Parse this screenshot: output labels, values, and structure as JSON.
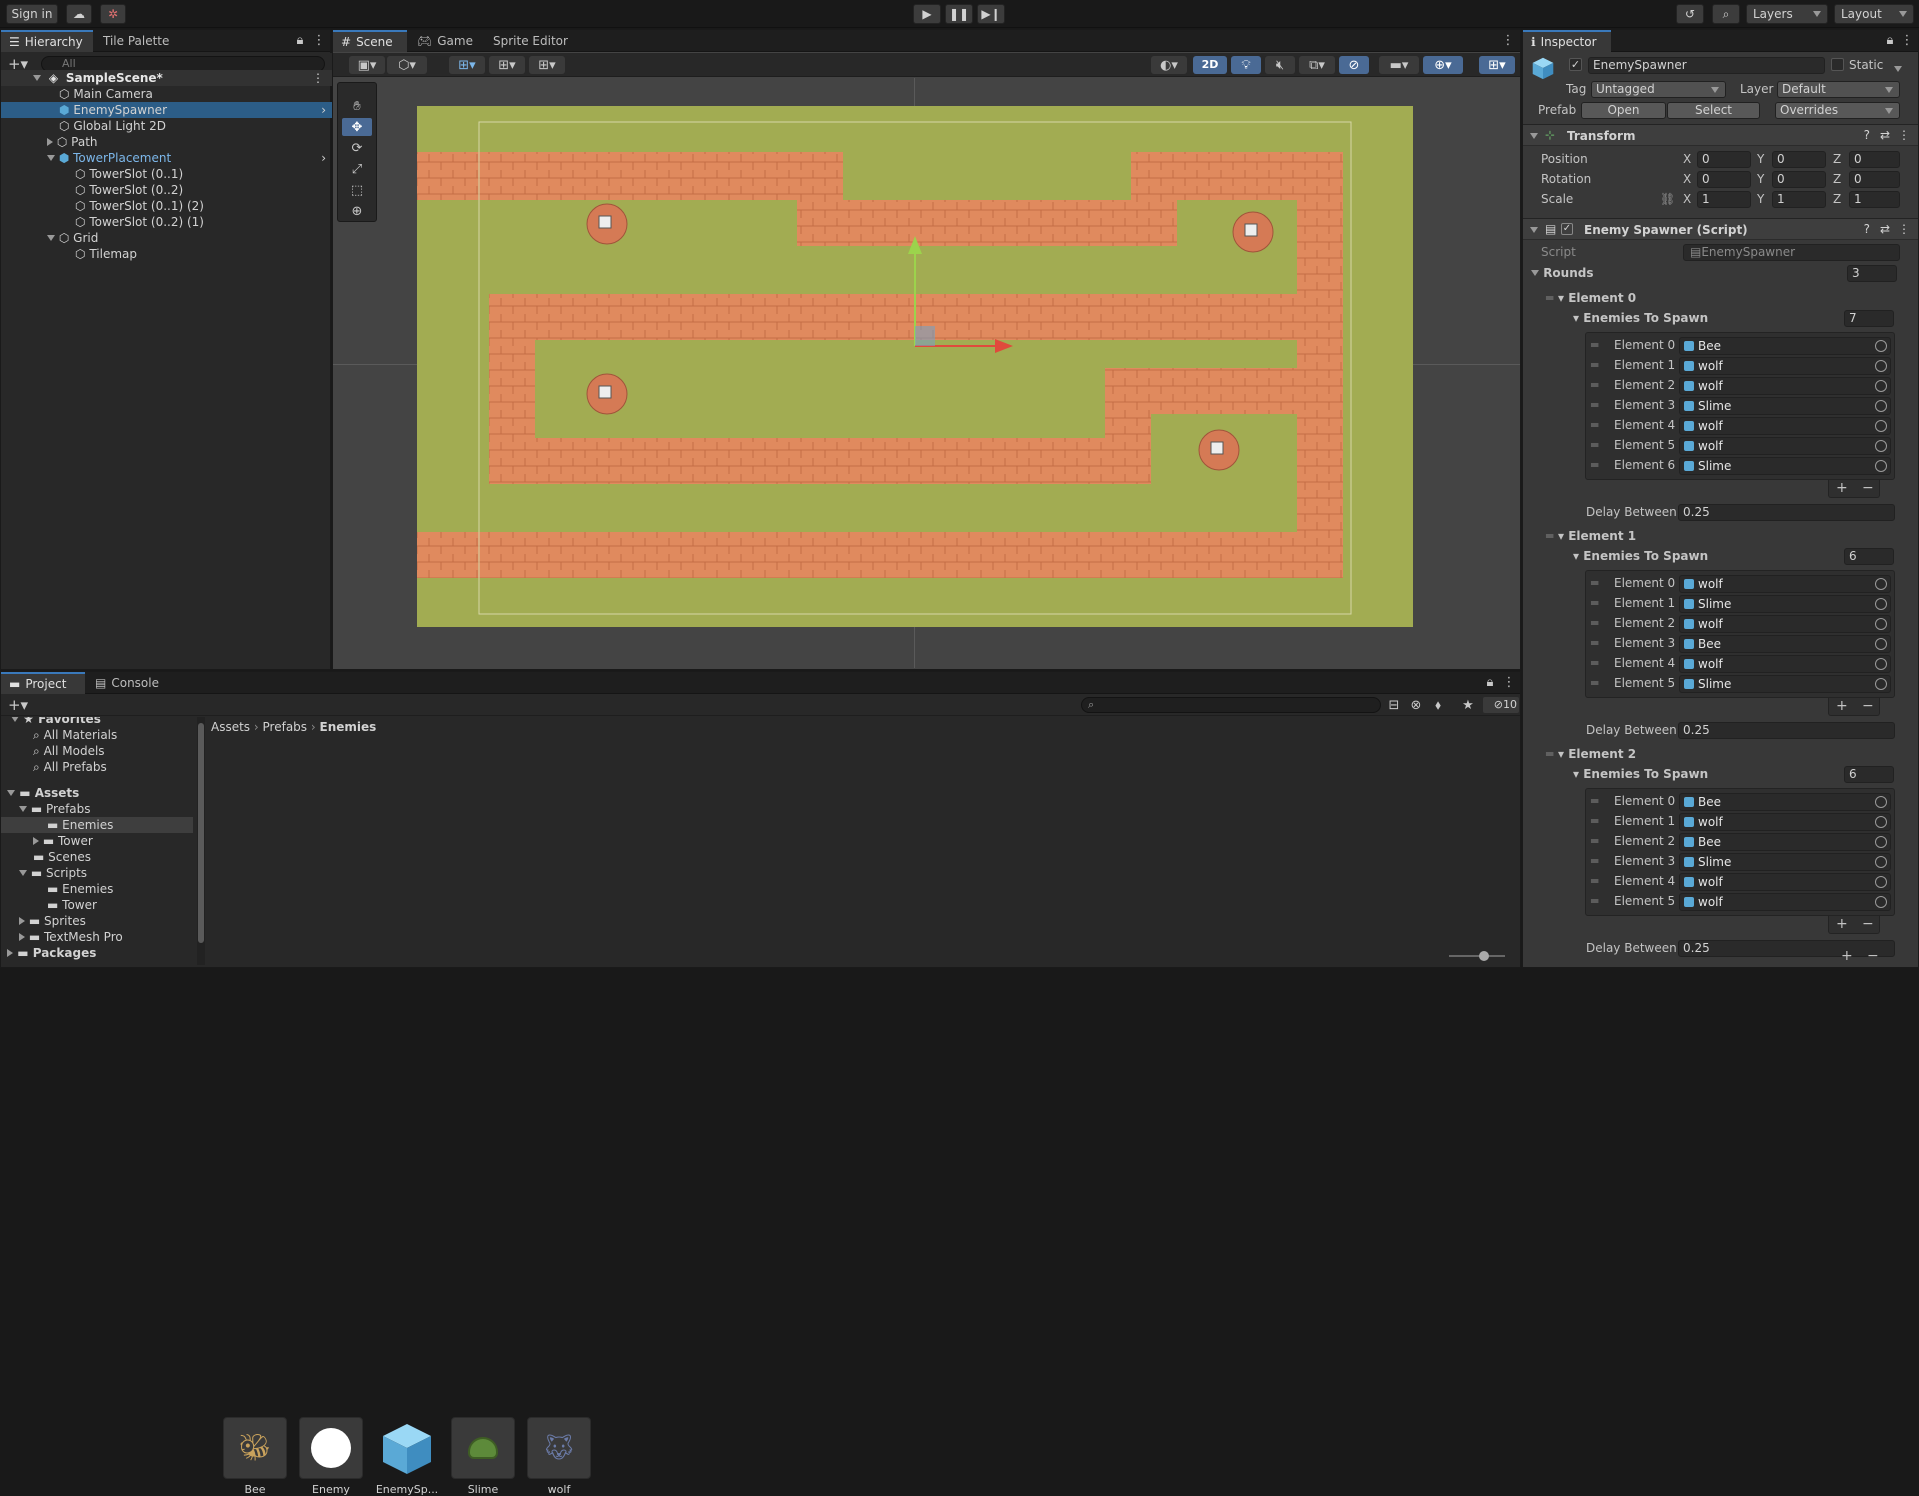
{
  "toolbar": {
    "signin": "Sign in",
    "layers": "Layers",
    "layout": "Layout"
  },
  "hierarchy": {
    "tabs": [
      "Hierarchy",
      "Tile Palette"
    ],
    "search_placeholder": "All",
    "scene": "SampleScene*",
    "items": [
      "Main Camera",
      "EnemySpawner",
      "Global Light 2D",
      "Path",
      "TowerPlacement",
      "TowerSlot (0..1)",
      "TowerSlot (0..2)",
      "TowerSlot (0..1) (2)",
      "TowerSlot (0..2) (1)",
      "Grid",
      "Tilemap"
    ]
  },
  "scene_view": {
    "tabs": [
      "Scene",
      "Game",
      "Sprite Editor"
    ],
    "mode_2d": "2D"
  },
  "project": {
    "tabs": [
      "Project",
      "Console"
    ],
    "favorites": {
      "title": "Favorites",
      "items": [
        "All Materials",
        "All Models",
        "All Prefabs"
      ]
    },
    "tree": [
      "Assets",
      "Prefabs",
      "Enemies",
      "Tower",
      "Scenes",
      "Scripts",
      "Enemies",
      "Tower",
      "Sprites",
      "TextMesh Pro",
      "Packages"
    ],
    "breadcrumb": [
      "Assets",
      "Prefabs",
      "Enemies"
    ],
    "hidden_count": "10",
    "assets": [
      "Bee",
      "Enemy",
      "EnemySp...",
      "Slime",
      "wolf"
    ]
  },
  "inspector": {
    "tab": "Inspector",
    "object_name": "EnemySpawner",
    "static_label": "Static",
    "tag_label": "Tag",
    "tag_value": "Untagged",
    "layer_label": "Layer",
    "layer_value": "Default",
    "prefab_label": "Prefab",
    "prefab_open": "Open",
    "prefab_select": "Select",
    "prefab_overrides": "Overrides",
    "transform": {
      "title": "Transform",
      "rows": [
        {
          "label": "Position",
          "x": "0",
          "y": "0",
          "z": "0"
        },
        {
          "label": "Rotation",
          "x": "0",
          "y": "0",
          "z": "0"
        },
        {
          "label": "Scale",
          "x": "1",
          "y": "1",
          "z": "1"
        }
      ],
      "axis": [
        "X",
        "Y",
        "Z"
      ]
    },
    "script_component": {
      "title": "Enemy Spawner (Script)",
      "script_label": "Script",
      "script_value": "EnemySpawner",
      "rounds_label": "Rounds",
      "rounds_count": "3",
      "enemies_label": "Enemies To Spawn",
      "delay_label": "Delay Between",
      "rounds": [
        {
          "name": "Element 0",
          "count": "7",
          "delay": "0.25",
          "enemies": [
            [
              "Element 0",
              "Bee"
            ],
            [
              "Element 1",
              "wolf"
            ],
            [
              "Element 2",
              "wolf"
            ],
            [
              "Element 3",
              "Slime"
            ],
            [
              "Element 4",
              "wolf"
            ],
            [
              "Element 5",
              "wolf"
            ],
            [
              "Element 6",
              "Slime"
            ]
          ]
        },
        {
          "name": "Element 1",
          "count": "6",
          "delay": "0.25",
          "enemies": [
            [
              "Element 0",
              "wolf"
            ],
            [
              "Element 1",
              "Slime"
            ],
            [
              "Element 2",
              "wolf"
            ],
            [
              "Element 3",
              "Bee"
            ],
            [
              "Element 4",
              "wolf"
            ],
            [
              "Element 5",
              "Slime"
            ]
          ]
        },
        {
          "name": "Element 2",
          "count": "6",
          "delay": "0.25",
          "enemies": [
            [
              "Element 0",
              "Bee"
            ],
            [
              "Element 1",
              "wolf"
            ],
            [
              "Element 2",
              "Bee"
            ],
            [
              "Element 3",
              "Slime"
            ],
            [
              "Element 4",
              "wolf"
            ],
            [
              "Element 5",
              "wolf"
            ]
          ]
        }
      ]
    }
  }
}
